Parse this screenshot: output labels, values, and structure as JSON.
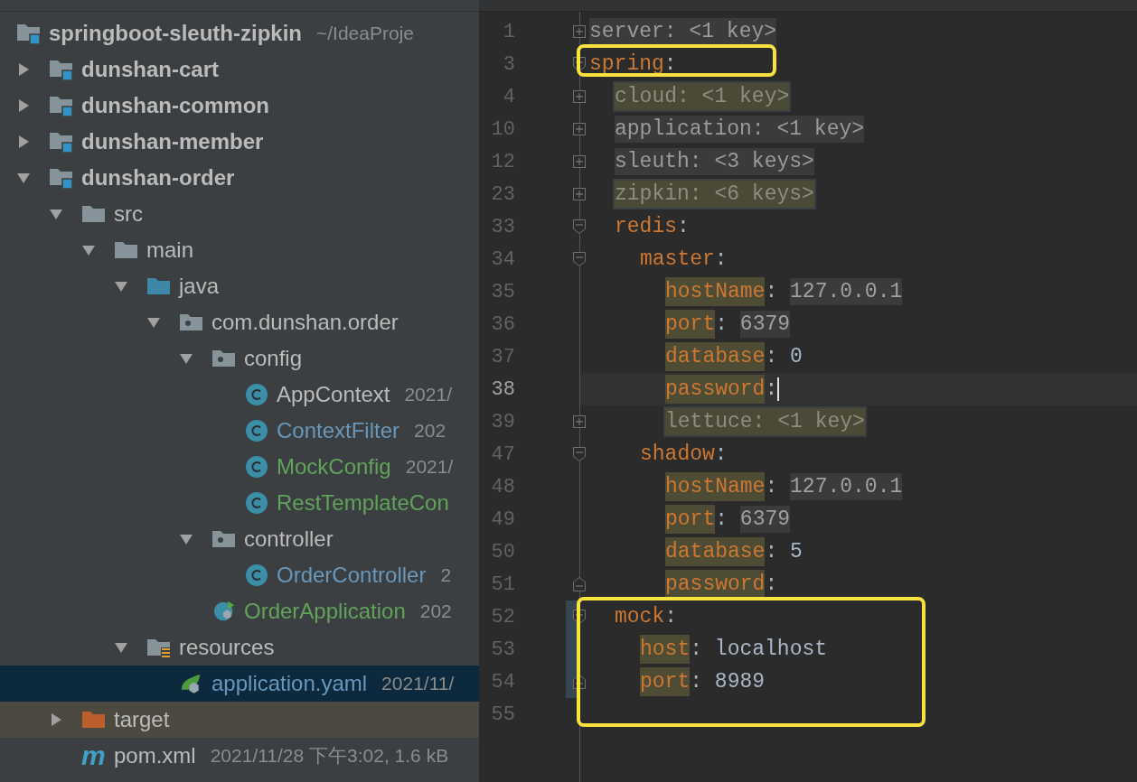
{
  "project_tree": {
    "label": "springboot-sleuth-zipkin",
    "kind": "project",
    "meta": "~/IdeaProje",
    "color": "#bbbbbb",
    "selected": false,
    "children": [
      {
        "label": "dunshan-cart",
        "kind": "module",
        "color": "#bbbbbb",
        "selected": false,
        "expanded": false
      },
      {
        "label": "dunshan-common",
        "kind": "module",
        "color": "#bbbbbb",
        "selected": false,
        "expanded": false
      },
      {
        "label": "dunshan-member",
        "kind": "module",
        "color": "#bbbbbb",
        "selected": false,
        "expanded": false
      },
      {
        "label": "dunshan-order",
        "kind": "module",
        "color": "#bbbbbb",
        "selected": false,
        "expanded": true,
        "children": [
          {
            "label": "src",
            "kind": "folder",
            "color": "#bbbbbb",
            "selected": false,
            "expanded": true,
            "children": [
              {
                "label": "main",
                "kind": "folder",
                "color": "#bbbbbb",
                "selected": false,
                "expanded": true,
                "children": [
                  {
                    "label": "java",
                    "kind": "source_folder",
                    "color": "#bbbbbb",
                    "selected": false,
                    "expanded": true,
                    "children": [
                      {
                        "label": "com.dunshan.order",
                        "kind": "package",
                        "color": "#bbbbbb",
                        "selected": false,
                        "expanded": true,
                        "children": [
                          {
                            "label": "config",
                            "kind": "package",
                            "color": "#bbbbbb",
                            "selected": false,
                            "expanded": true,
                            "children": [
                              {
                                "label": "AppContext",
                                "kind": "class",
                                "meta": "2021/",
                                "color": "#bbbbbb",
                                "selected": false
                              },
                              {
                                "label": "ContextFilter",
                                "kind": "class",
                                "meta": "202",
                                "color": "#6897bb",
                                "selected": false
                              },
                              {
                                "label": "MockConfig",
                                "kind": "class",
                                "meta": "2021/",
                                "color": "#62a35c",
                                "selected": false
                              },
                              {
                                "label": "RestTemplateCon",
                                "kind": "class",
                                "color": "#62a35c",
                                "selected": false
                              }
                            ]
                          },
                          {
                            "label": "controller",
                            "kind": "package",
                            "color": "#bbbbbb",
                            "selected": false,
                            "expanded": true,
                            "children": [
                              {
                                "label": "OrderController",
                                "kind": "class",
                                "meta": "2",
                                "color": "#6897bb",
                                "selected": false
                              }
                            ]
                          },
                          {
                            "label": "OrderApplication",
                            "kind": "app_class",
                            "meta": "202",
                            "color": "#62a35c",
                            "selected": false
                          }
                        ]
                      }
                    ]
                  },
                  {
                    "label": "resources",
                    "kind": "resources",
                    "color": "#bbbbbb",
                    "selected": false,
                    "expanded": true,
                    "children": [
                      {
                        "label": "application.yaml",
                        "kind": "yaml",
                        "meta": "2021/11/",
                        "color": "#6897bb",
                        "selected": true
                      }
                    ]
                  }
                ]
              }
            ]
          },
          {
            "label": "target",
            "kind": "excluded_folder",
            "color": "#bbbbbb",
            "selected": false,
            "expanded": false
          },
          {
            "label": "pom.xml",
            "kind": "maven",
            "badge": "m",
            "meta": "2021/11/28 下午3:02, 1.6 kB",
            "color": "#bbbbbb",
            "selected": false
          }
        ]
      }
    ]
  },
  "editor": {
    "lines": [
      {
        "number": "1",
        "kind": "collapsed",
        "text": "server: <1 key>",
        "highlighted": false,
        "current": false,
        "changed": false
      },
      {
        "number": "3",
        "kind": "open",
        "key": "spring",
        "sep": ":",
        "boxed": true,
        "current": false,
        "changed": false,
        "children": [
          {
            "number": "4",
            "kind": "collapsed",
            "text": "cloud: <1 key>",
            "highlighted": true,
            "current": false,
            "changed": false
          },
          {
            "number": "10",
            "kind": "collapsed",
            "text": "application: <1 key>",
            "highlighted": false,
            "current": false,
            "changed": false
          },
          {
            "number": "12",
            "kind": "collapsed",
            "text": "sleuth: <3 keys>",
            "highlighted": false,
            "current": false,
            "changed": false
          },
          {
            "number": "23",
            "kind": "collapsed",
            "text": "zipkin: <6 keys>",
            "highlighted": true,
            "current": false,
            "changed": false
          },
          {
            "number": "33",
            "kind": "open",
            "key": "redis",
            "sep": ":",
            "key_highlighted": false,
            "current": false,
            "changed": false,
            "children": [
              {
                "number": "34",
                "kind": "open",
                "key": "master",
                "sep": ":",
                "key_highlighted": false,
                "current": false,
                "changed": false,
                "children": [
                  {
                    "number": "35",
                    "kind": "plain",
                    "key": "hostName",
                    "sep": ": ",
                    "value": "127.0.0.1",
                    "key_highlighted": true,
                    "value_highlighted": true,
                    "current": false,
                    "changed": false
                  },
                  {
                    "number": "36",
                    "kind": "plain",
                    "key": "port",
                    "sep": ": ",
                    "value": "6379",
                    "key_highlighted": true,
                    "value_highlighted": true,
                    "current": false,
                    "changed": false
                  },
                  {
                    "number": "37",
                    "kind": "plain",
                    "key": "database",
                    "sep": ": ",
                    "value": "0",
                    "key_highlighted": true,
                    "value_highlighted": false,
                    "current": false,
                    "changed": false
                  },
                  {
                    "number": "38",
                    "kind": "plain",
                    "key": "password",
                    "sep": ":",
                    "key_highlighted": true,
                    "current": true,
                    "changed": false
                  },
                  {
                    "number": "39",
                    "kind": "collapsed",
                    "text": "lettuce: <1 key>",
                    "highlighted": true,
                    "current": false,
                    "changed": false
                  }
                ]
              },
              {
                "number": "47",
                "kind": "open",
                "key": "shadow",
                "sep": ":",
                "key_highlighted": false,
                "current": false,
                "changed": false,
                "children": [
                  {
                    "number": "48",
                    "kind": "plain",
                    "key": "hostName",
                    "sep": ": ",
                    "value": "127.0.0.1",
                    "key_highlighted": true,
                    "value_highlighted": true,
                    "current": false,
                    "changed": false
                  },
                  {
                    "number": "49",
                    "kind": "plain",
                    "key": "port",
                    "sep": ": ",
                    "value": "6379",
                    "key_highlighted": true,
                    "value_highlighted": true,
                    "current": false,
                    "changed": false
                  },
                  {
                    "number": "50",
                    "kind": "plain",
                    "key": "database",
                    "sep": ": ",
                    "value": "5",
                    "key_highlighted": true,
                    "value_highlighted": false,
                    "current": false,
                    "changed": false
                  },
                  {
                    "number": "51",
                    "kind": "close",
                    "key": "password",
                    "sep": ":",
                    "key_highlighted": true,
                    "current": false,
                    "changed": false
                  }
                ]
              }
            ]
          },
          {
            "number": "52",
            "kind": "open",
            "key": "mock",
            "sep": ":",
            "key_highlighted": false,
            "boxed": true,
            "current": false,
            "changed": true,
            "children": [
              {
                "number": "53",
                "kind": "plain",
                "key": "host",
                "sep": ": ",
                "value": "localhost",
                "key_highlighted": true,
                "value_highlighted": false,
                "boxed": true,
                "current": false,
                "changed": true
              },
              {
                "number": "54",
                "kind": "close",
                "key": "port",
                "sep": ": ",
                "value": "8989",
                "key_highlighted": true,
                "value_highlighted": false,
                "boxed": true,
                "current": false,
                "changed": true
              }
            ]
          }
        ]
      },
      {
        "number": "55",
        "kind": "plain",
        "boxed": true,
        "current": false,
        "changed": false
      }
    ]
  }
}
